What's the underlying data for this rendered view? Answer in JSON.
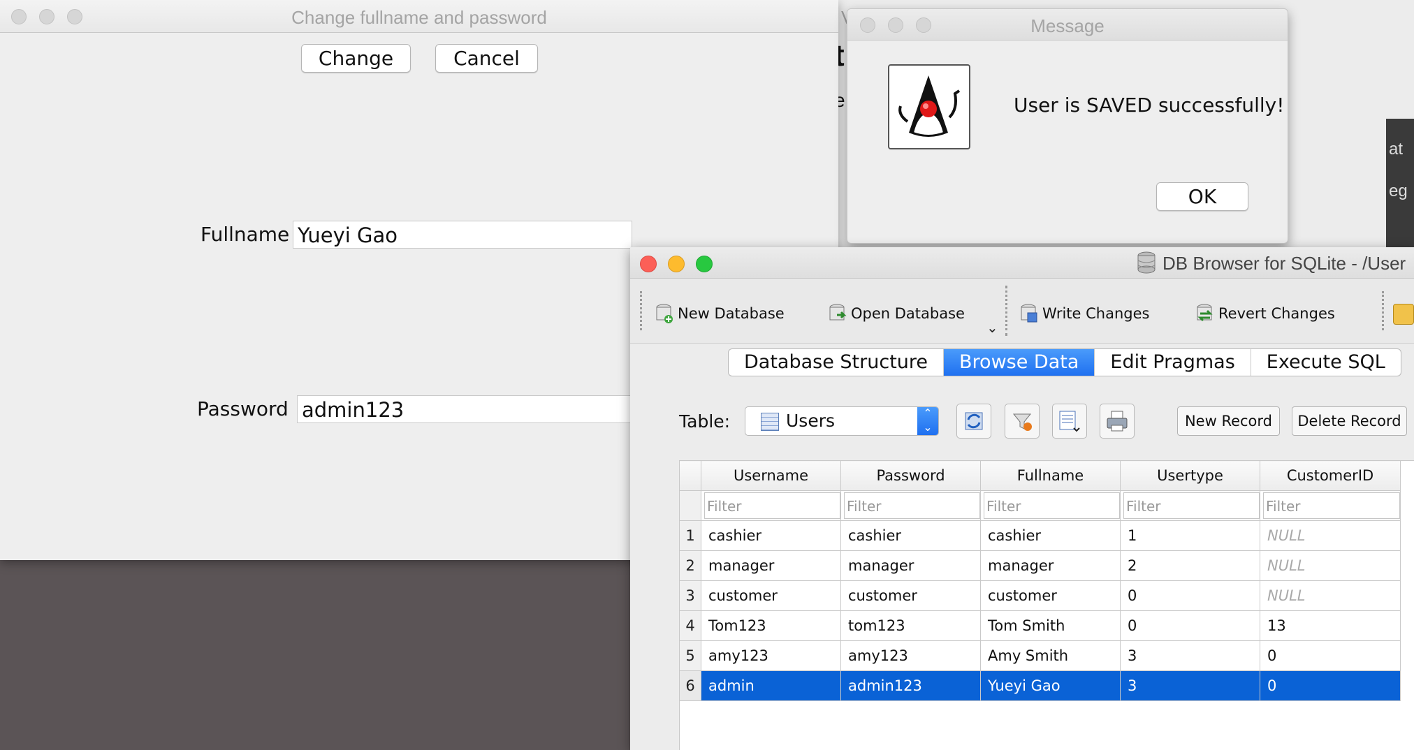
{
  "change_dialog": {
    "title": "Change fullname and password",
    "change_button": "Change",
    "cancel_button": "Cancel",
    "fullname_label": "Fullname",
    "fullname_value": "Yueyi Gao",
    "password_label": "Password",
    "password_value": "admin123"
  },
  "message_dialog": {
    "title": "Message",
    "text": "User is SAVED successfully!",
    "ok_button": "OK"
  },
  "background_window": {
    "title_fragment": "V",
    "text_fragment": "t",
    "text_fragment_2": "e"
  },
  "dbbrowser": {
    "title": "DB Browser for SQLite - /User",
    "toolbar": {
      "new_database": "New Database",
      "open_database": "Open Database",
      "write_changes": "Write Changes",
      "revert_changes": "Revert Changes"
    },
    "tabs": [
      "Database Structure",
      "Browse Data",
      "Edit Pragmas",
      "Execute SQL"
    ],
    "active_tab": "Browse Data",
    "table_label": "Table:",
    "table_selected": "Users",
    "new_record": "New Record",
    "delete_record": "Delete Record",
    "filter_placeholder": "Filter",
    "columns": [
      "Username",
      "Password",
      "Fullname",
      "Usertype",
      "CustomerID"
    ],
    "rows": [
      {
        "n": "1",
        "cells": [
          "cashier",
          "cashier",
          "cashier",
          "1",
          "NULL"
        ]
      },
      {
        "n": "2",
        "cells": [
          "manager",
          "manager",
          "manager",
          "2",
          "NULL"
        ]
      },
      {
        "n": "3",
        "cells": [
          "customer",
          "customer",
          "customer",
          "0",
          "NULL"
        ]
      },
      {
        "n": "4",
        "cells": [
          "Tom123",
          "tom123",
          "Tom Smith",
          "0",
          "13"
        ]
      },
      {
        "n": "5",
        "cells": [
          "amy123",
          "amy123",
          "Amy Smith",
          "3",
          "0"
        ]
      },
      {
        "n": "6",
        "cells": [
          "admin",
          "admin123",
          "Yueyi Gao",
          "3",
          "0"
        ]
      }
    ],
    "selected_row": 6
  },
  "right_edge_fragments": [
    "at",
    "eg"
  ]
}
